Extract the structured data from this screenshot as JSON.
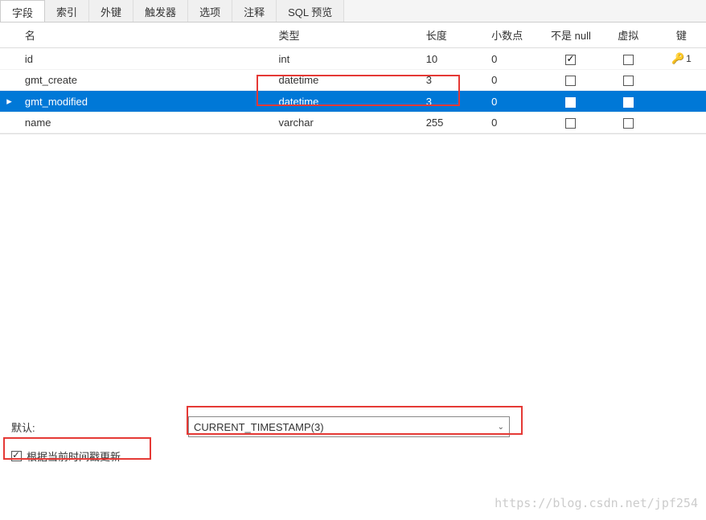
{
  "tabs": {
    "fields": "字段",
    "indexes": "索引",
    "foreign_keys": "外键",
    "triggers": "触发器",
    "options": "选项",
    "comment": "注释",
    "sql_preview": "SQL 预览"
  },
  "headers": {
    "name": "名",
    "type": "类型",
    "length": "长度",
    "decimal": "小数点",
    "not_null": "不是 null",
    "virtual": "虚拟",
    "key": "键"
  },
  "rows": [
    {
      "name": "id",
      "type": "int",
      "length": "10",
      "decimal": "0",
      "not_null": true,
      "virtual": false,
      "key": "1"
    },
    {
      "name": "gmt_create",
      "type": "datetime",
      "length": "3",
      "decimal": "0",
      "not_null": false,
      "virtual": false,
      "key": ""
    },
    {
      "name": "gmt_modified",
      "type": "datetime",
      "length": "3",
      "decimal": "0",
      "not_null": false,
      "virtual": false,
      "key": ""
    },
    {
      "name": "name",
      "type": "varchar",
      "length": "255",
      "decimal": "0",
      "not_null": false,
      "virtual": false,
      "key": ""
    }
  ],
  "selected_row_index": 2,
  "detail": {
    "default_label": "默认:",
    "default_value": "CURRENT_TIMESTAMP(3)",
    "on_update_label": "根据当前时间戳更新",
    "on_update_checked": true
  },
  "watermark": "https://blog.csdn.net/jpf254"
}
